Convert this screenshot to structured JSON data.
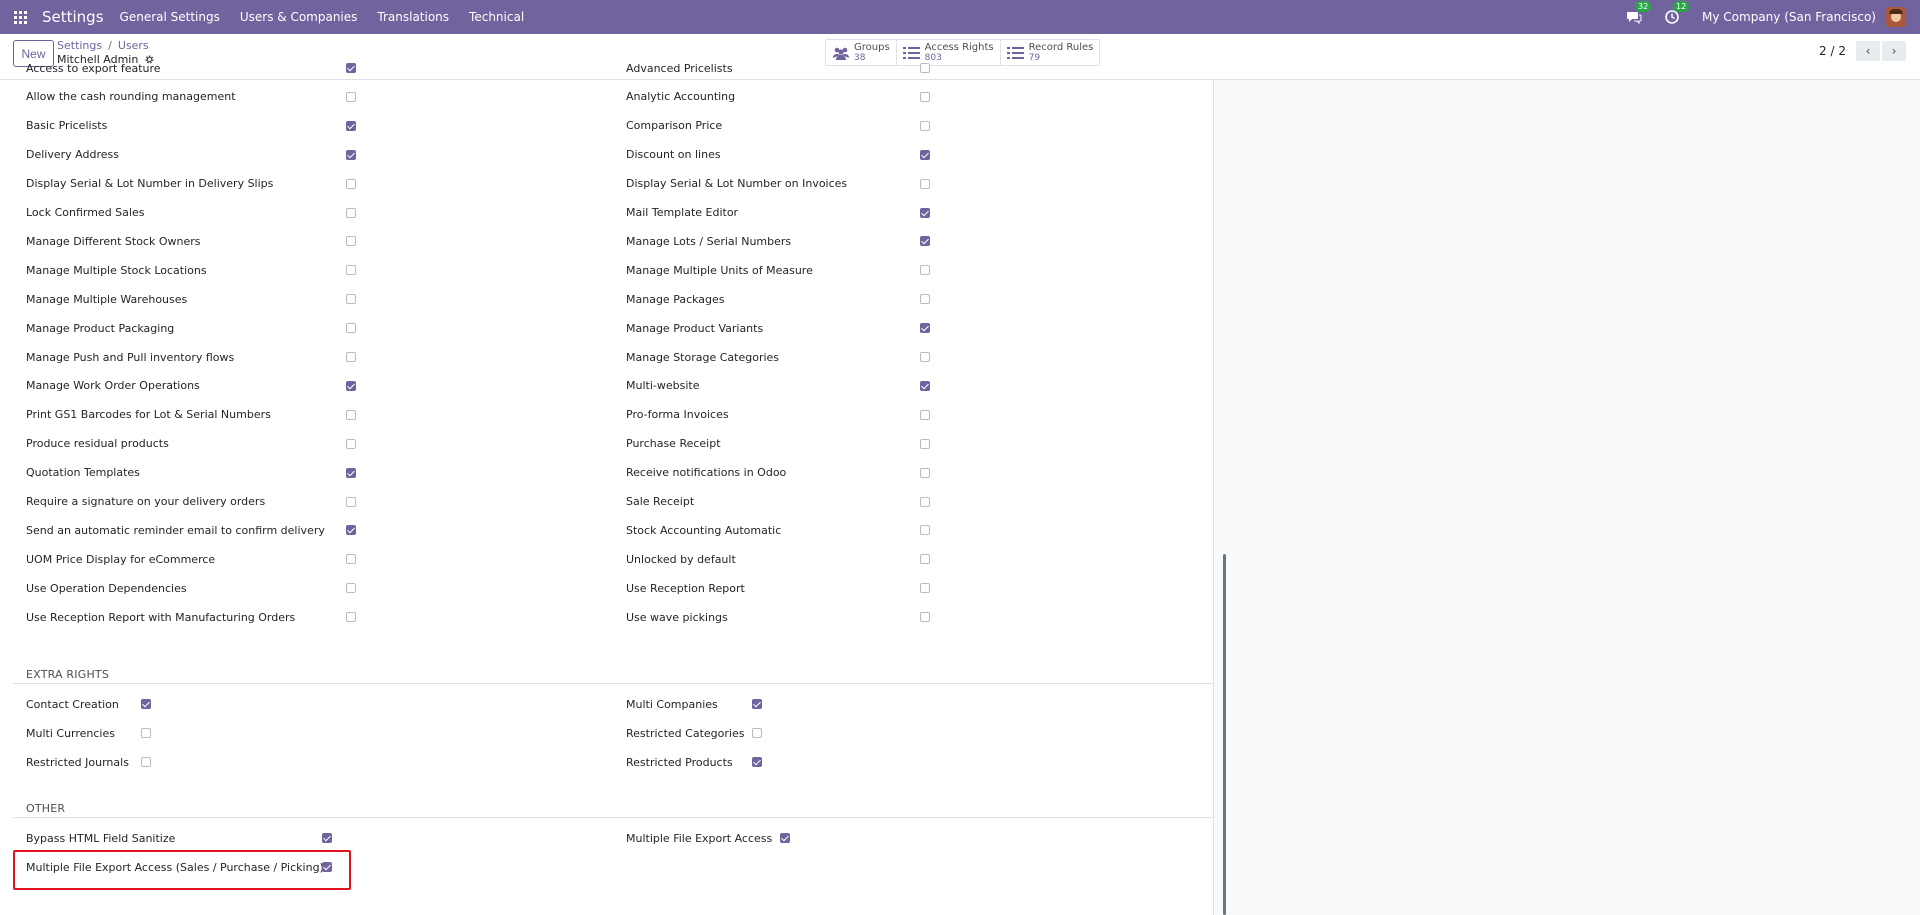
{
  "navbar": {
    "app_name": "Settings",
    "menu": [
      "General Settings",
      "Users & Companies",
      "Translations",
      "Technical"
    ],
    "messages_badge": "32",
    "activities_badge": "12",
    "company": "My Company (San Francisco)"
  },
  "control": {
    "new_label": "New",
    "breadcrumb_settings": "Settings",
    "breadcrumb_users": "Users",
    "record_name": "Mitchell Admin",
    "stats": [
      {
        "label": "Groups",
        "value": "38"
      },
      {
        "label": "Access Rights",
        "value": "803"
      },
      {
        "label": "Record Rules",
        "value": "79"
      }
    ],
    "pager": "2 / 2"
  },
  "technical_rights": {
    "left": [
      {
        "label": "Access to export feature",
        "checked": true
      },
      {
        "label": "Allow the cash rounding management",
        "checked": false
      },
      {
        "label": "Basic Pricelists",
        "checked": true
      },
      {
        "label": "Delivery Address",
        "checked": true
      },
      {
        "label": "Display Serial & Lot Number in Delivery Slips",
        "checked": false
      },
      {
        "label": "Lock Confirmed Sales",
        "checked": false
      },
      {
        "label": "Manage Different Stock Owners",
        "checked": false
      },
      {
        "label": "Manage Multiple Stock Locations",
        "checked": false
      },
      {
        "label": "Manage Multiple Warehouses",
        "checked": false
      },
      {
        "label": "Manage Product Packaging",
        "checked": false
      },
      {
        "label": "Manage Push and Pull inventory flows",
        "checked": false
      },
      {
        "label": "Manage Work Order Operations",
        "checked": true
      },
      {
        "label": "Print GS1 Barcodes for Lot & Serial Numbers",
        "checked": false
      },
      {
        "label": "Produce residual products",
        "checked": false
      },
      {
        "label": "Quotation Templates",
        "checked": true
      },
      {
        "label": "Require a signature on your delivery orders",
        "checked": false
      },
      {
        "label": "Send an automatic reminder email to confirm delivery",
        "checked": true
      },
      {
        "label": "UOM Price Display for eCommerce",
        "checked": false
      },
      {
        "label": "Use Operation Dependencies",
        "checked": false
      },
      {
        "label": "Use Reception Report with Manufacturing Orders",
        "checked": false
      }
    ],
    "right": [
      {
        "label": "Advanced Pricelists",
        "checked": false
      },
      {
        "label": "Analytic Accounting",
        "checked": false
      },
      {
        "label": "Comparison Price",
        "checked": false
      },
      {
        "label": "Discount on lines",
        "checked": true
      },
      {
        "label": "Display Serial & Lot Number on Invoices",
        "checked": false
      },
      {
        "label": "Mail Template Editor",
        "checked": true
      },
      {
        "label": "Manage Lots / Serial Numbers",
        "checked": true
      },
      {
        "label": "Manage Multiple Units of Measure",
        "checked": false
      },
      {
        "label": "Manage Packages",
        "checked": false
      },
      {
        "label": "Manage Product Variants",
        "checked": true
      },
      {
        "label": "Manage Storage Categories",
        "checked": false
      },
      {
        "label": "Multi-website",
        "checked": true
      },
      {
        "label": "Pro-forma Invoices",
        "checked": false
      },
      {
        "label": "Purchase Receipt",
        "checked": false
      },
      {
        "label": "Receive notifications in Odoo",
        "checked": false
      },
      {
        "label": "Sale Receipt",
        "checked": false
      },
      {
        "label": "Stock Accounting Automatic",
        "checked": false
      },
      {
        "label": "Unlocked by default",
        "checked": false
      },
      {
        "label": "Use Reception Report",
        "checked": false
      },
      {
        "label": "Use wave pickings",
        "checked": false
      }
    ]
  },
  "extra_rights": {
    "title": "EXTRA RIGHTS",
    "left": [
      {
        "label": "Contact Creation",
        "checked": true
      },
      {
        "label": "Multi Currencies",
        "checked": false
      },
      {
        "label": "Restricted Journals",
        "checked": false
      }
    ],
    "right": [
      {
        "label": "Multi Companies",
        "checked": true
      },
      {
        "label": "Restricted Categories",
        "checked": false
      },
      {
        "label": "Restricted Products",
        "checked": true
      }
    ]
  },
  "other": {
    "title": "OTHER",
    "left": [
      {
        "label": "Bypass HTML Field Sanitize",
        "checked": true
      },
      {
        "label": "Multiple File Export Access (Sales / Purchase / Picking)",
        "checked": true
      }
    ],
    "right": [
      {
        "label": "Multiple File Export Access",
        "checked": true
      }
    ]
  }
}
